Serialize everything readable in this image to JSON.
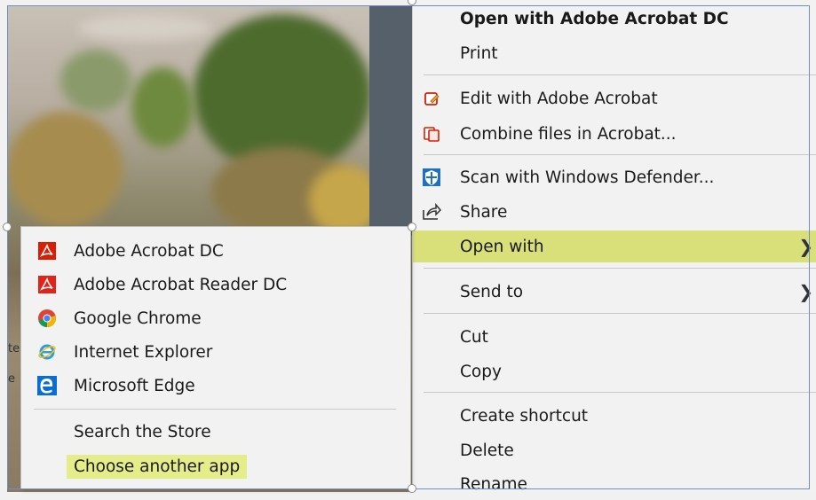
{
  "context_menu": {
    "items": [
      {
        "label": "Open with Adobe Acrobat DC",
        "icon": "none"
      },
      {
        "label": "Print",
        "icon": "none"
      },
      {
        "label": "Edit with Adobe Acrobat",
        "icon": "acrobat-edit-icon"
      },
      {
        "label": "Combine files in Acrobat...",
        "icon": "acrobat-combine-icon"
      },
      {
        "label": "Scan with Windows Defender...",
        "icon": "windows-defender-icon"
      },
      {
        "label": "Share",
        "icon": "share-icon"
      },
      {
        "label": "Open with",
        "icon": "none",
        "submenu": true,
        "highlighted": true
      },
      {
        "label": "Send to",
        "icon": "none",
        "submenu": true
      },
      {
        "label": "Cut",
        "icon": "none"
      },
      {
        "label": "Copy",
        "icon": "none"
      },
      {
        "label": "Create shortcut",
        "icon": "none"
      },
      {
        "label": "Delete",
        "icon": "none"
      },
      {
        "label": "Rename",
        "icon": "none"
      }
    ],
    "submenu_arrow": "❯"
  },
  "open_with_submenu": {
    "items": [
      {
        "label": "Adobe Acrobat DC",
        "icon": "adobe-acrobat-icon"
      },
      {
        "label": "Adobe Acrobat Reader DC",
        "icon": "adobe-reader-icon"
      },
      {
        "label": "Google Chrome",
        "icon": "chrome-icon"
      },
      {
        "label": "Internet Explorer",
        "icon": "internet-explorer-icon"
      },
      {
        "label": "Microsoft Edge",
        "icon": "edge-icon"
      },
      {
        "label": "Search the Store",
        "icon": "none"
      },
      {
        "label": "Choose another app",
        "icon": "none",
        "highlighted": true
      }
    ]
  },
  "colors": {
    "highlight": "#d9e07a",
    "menu_bg": "#f2f2f2",
    "acrobat_red": "#d81e05",
    "defender_blue": "#1e6fc6",
    "edge_blue": "#0a6ed1"
  }
}
